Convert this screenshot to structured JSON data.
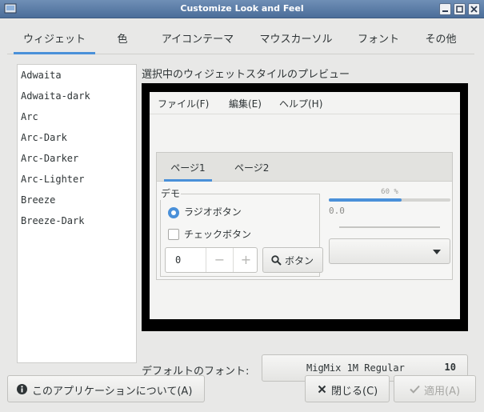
{
  "window": {
    "title": "Customize Look and Feel"
  },
  "tabs": [
    {
      "label": "ウィジェット",
      "active": true
    },
    {
      "label": "色"
    },
    {
      "label": "アイコンテーマ"
    },
    {
      "label": "マウスカーソル"
    },
    {
      "label": "フォント"
    },
    {
      "label": "その他"
    }
  ],
  "themes": [
    "Adwaita",
    "Adwaita-dark",
    "Arc",
    "Arc-Dark",
    "Arc-Darker",
    "Arc-Lighter",
    "Breeze",
    "Breeze-Dark"
  ],
  "preview": {
    "label": "選択中のウィジェットスタイルのプレビュー",
    "menu": [
      "ファイル(F)",
      "編集(E)",
      "ヘルプ(H)"
    ],
    "notebook_tabs": [
      "ページ1",
      "ページ2"
    ],
    "demo_label": "デモ",
    "radio_label": "ラジオボタン",
    "check_label": "チェックボタン",
    "spin_value": "0",
    "spin_minus": "−",
    "spin_plus": "+",
    "button_label": "ボタン",
    "progress_text": "60 %",
    "progress_fraction": 0.6,
    "slider_value": "0.0"
  },
  "font": {
    "label": "デフォルトのフォント:",
    "name": "MigMix 1M Regular",
    "size": "10"
  },
  "buttons": {
    "about": "このアプリケーションについて(A)",
    "close": "閉じる(C)",
    "apply": "適用(A)"
  },
  "colors": {
    "accent": "#4a90d9",
    "titlebar": "#5a7ba8"
  }
}
